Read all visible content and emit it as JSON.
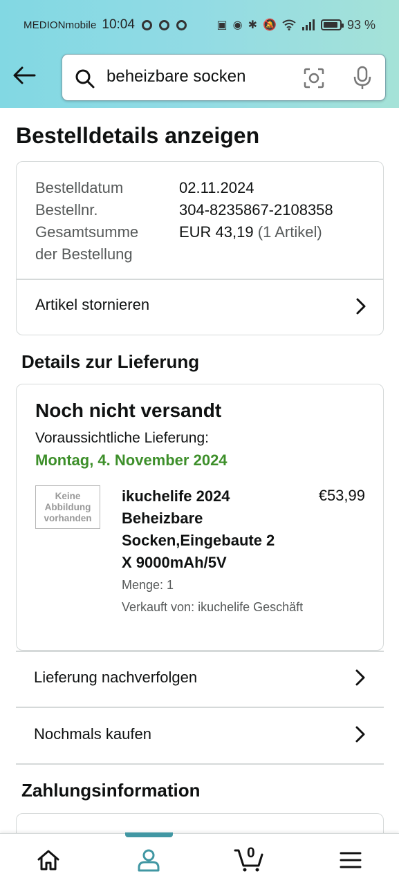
{
  "status_bar": {
    "carrier": "MEDIONmobile",
    "time": "10:04",
    "battery_percent": "93 %",
    "battery_level": 0.93
  },
  "header": {
    "search_value": "beheizbare socken"
  },
  "page": {
    "title": "Bestelldetails anzeigen"
  },
  "order_summary": {
    "date_label": "Bestelldatum",
    "date_value": "02.11.2024",
    "number_label": "Bestellnr.",
    "number_value": "304-8235867-2108358",
    "total_label_line1": "Gesamtsumme",
    "total_label_line2": "der Bestellung",
    "total_value": "EUR 43,19",
    "total_items": "(1 Artikel)",
    "cancel_label": "Artikel stornieren"
  },
  "delivery": {
    "section_title": "Details zur Lieferung",
    "status": "Noch nicht versandt",
    "eta_label": "Voraussichtliche Lieferung:",
    "eta_date": "Montag, 4. November 2024",
    "accent_color": "#3d8f2a",
    "item": {
      "no_image_text": "Keine Abbildung vorhanden",
      "title": "ikuchelife 2024 Beheizbare Socken,Eingebaute 2 X 9000mAh/5V",
      "price": "€53,99",
      "quantity": "Menge: 1",
      "seller": "Verkauft von: ikuchelife Geschäft"
    }
  },
  "actions": {
    "track": "Lieferung nachverfolgen",
    "buy_again": "Nochmals kaufen"
  },
  "payment": {
    "section_title": "Zahlungsinformation"
  },
  "bottom_nav": {
    "cart_count": "0",
    "active_tab": "account",
    "active_color": "#4197a3"
  }
}
